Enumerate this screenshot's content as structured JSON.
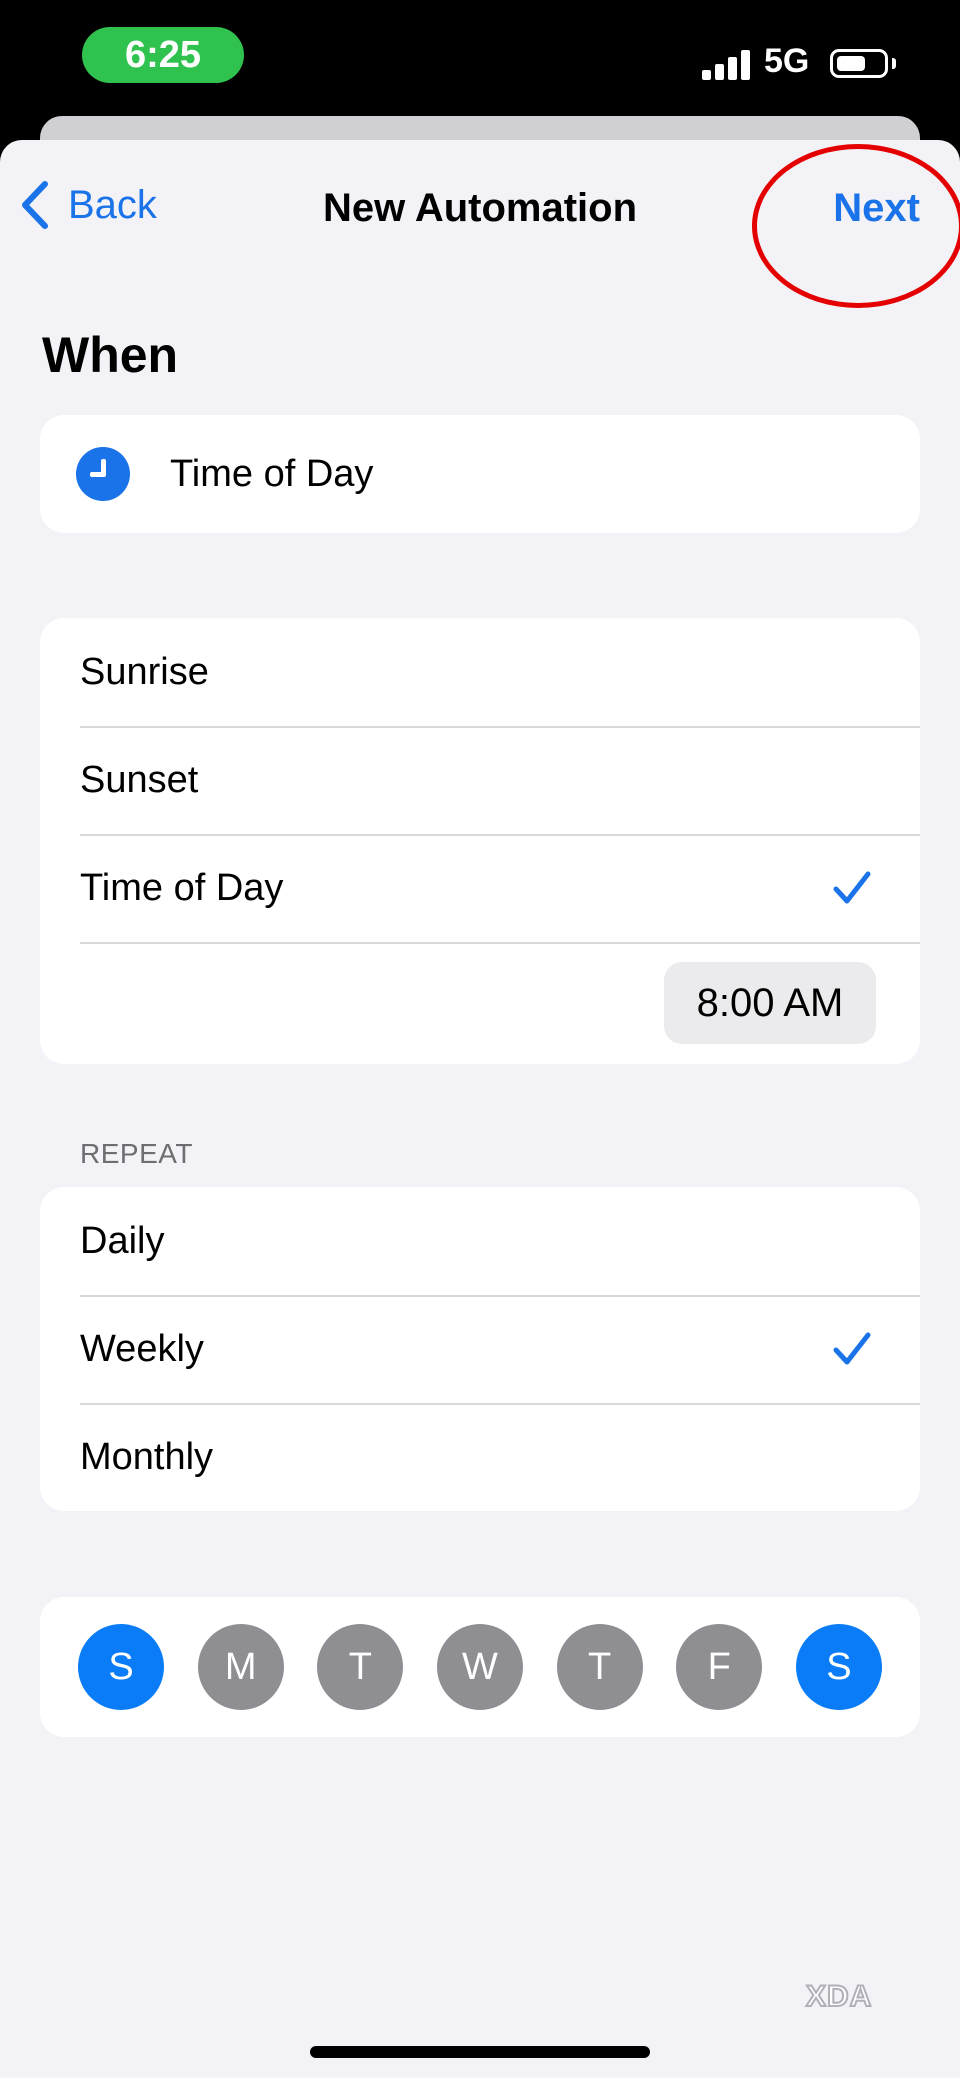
{
  "status_bar": {
    "time": "6:25",
    "network": "5G"
  },
  "nav": {
    "back_label": "Back",
    "title": "New Automation",
    "next_label": "Next"
  },
  "when": {
    "title": "When",
    "trigger_label": "Time of Day"
  },
  "time_options": [
    {
      "label": "Sunrise",
      "selected": false
    },
    {
      "label": "Sunset",
      "selected": false
    },
    {
      "label": "Time of Day",
      "selected": true
    }
  ],
  "selected_time": "8:00 AM",
  "repeat": {
    "header": "REPEAT",
    "options": [
      {
        "label": "Daily",
        "selected": false
      },
      {
        "label": "Weekly",
        "selected": true
      },
      {
        "label": "Monthly",
        "selected": false
      }
    ]
  },
  "days": [
    {
      "label": "S",
      "selected": true
    },
    {
      "label": "M",
      "selected": false
    },
    {
      "label": "T",
      "selected": false
    },
    {
      "label": "W",
      "selected": false
    },
    {
      "label": "T",
      "selected": false
    },
    {
      "label": "F",
      "selected": false
    },
    {
      "label": "S",
      "selected": true
    }
  ],
  "watermark": "XDA",
  "colors": {
    "accent": "#1a73e8",
    "day_on": "#0a7cf7",
    "day_off": "#8e8e93",
    "highlight_circle": "#e40000",
    "time_pill": "#30c24f"
  }
}
